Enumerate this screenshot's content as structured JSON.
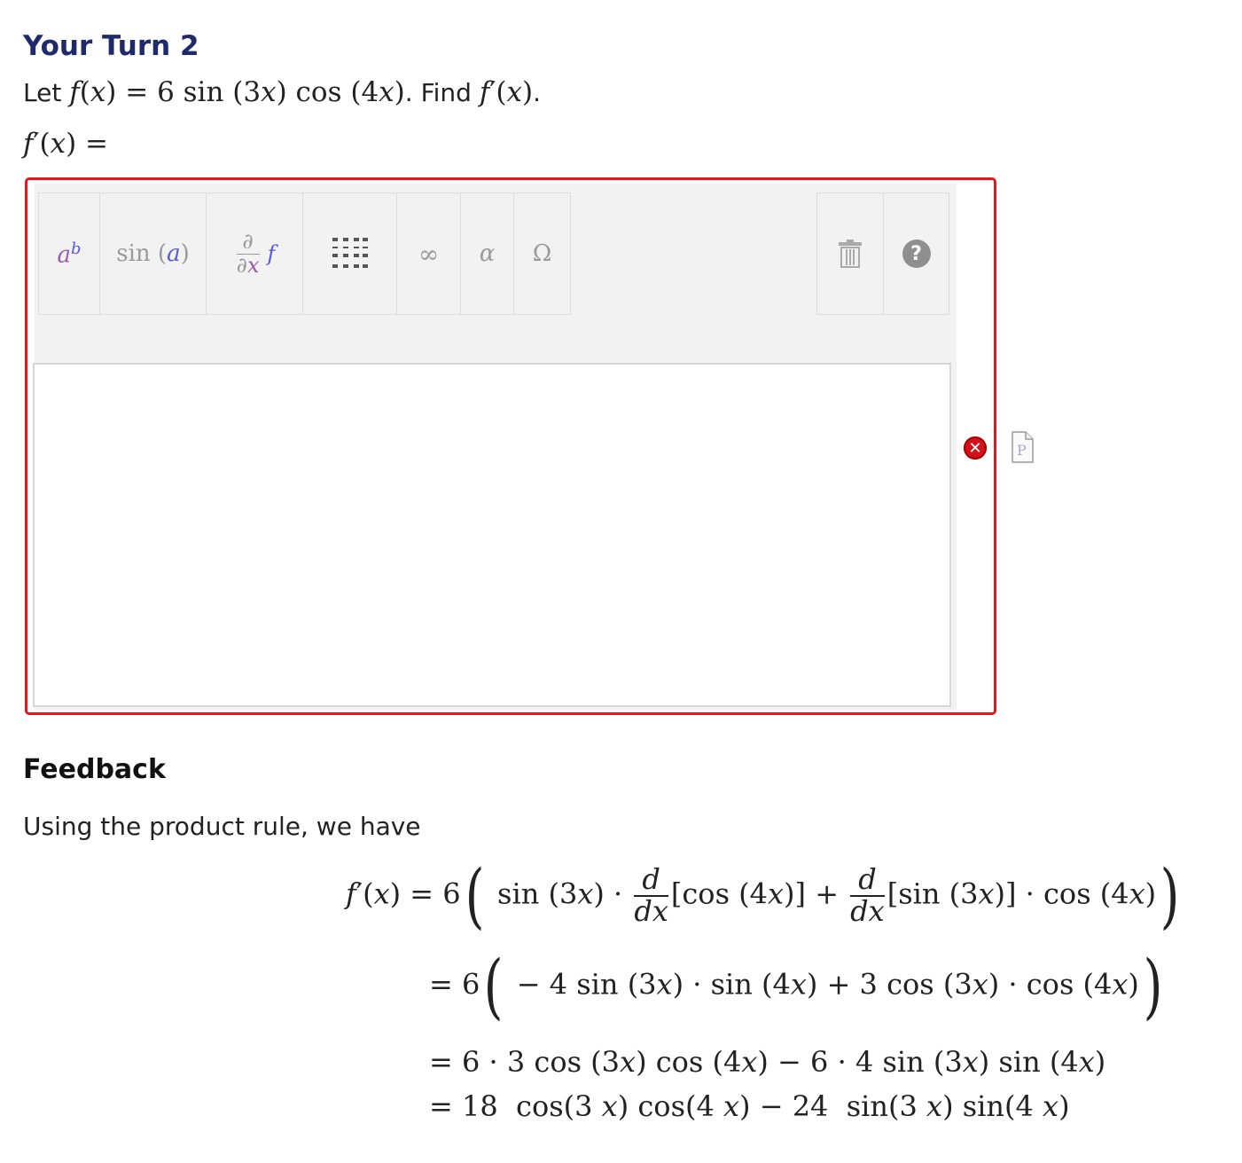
{
  "heading": "Your Turn 2",
  "prompt": {
    "lead": "Let",
    "function_def": "f(x) = 6 sin (3x) cos (4x)",
    "period": ".",
    "find_word": "Find",
    "target": "f′(x)",
    "end": "."
  },
  "answer_prefix": "f′(x) =",
  "toolbar": {
    "buttons": [
      {
        "name": "exponent",
        "label": "a^b"
      },
      {
        "name": "trig",
        "label": "sin (a)"
      },
      {
        "name": "derivative",
        "label": "∂/∂x f"
      },
      {
        "name": "matrix",
        "label": "matrix"
      },
      {
        "name": "infinity",
        "label": "∞"
      },
      {
        "name": "greek",
        "label": "α"
      },
      {
        "name": "symbols",
        "label": "Ω"
      }
    ],
    "trig_label": "sin (a)",
    "infinity_label": "∞",
    "alpha_label": "α",
    "omega_label": "Ω",
    "help_label": "?"
  },
  "answer_value": "",
  "status": {
    "icon": "error-x-icon",
    "color": "#d3121b"
  },
  "preview_icon": "preview-document-icon",
  "feedback": {
    "title": "Feedback",
    "intro": "Using the product rule, we have",
    "lines": [
      "f′(x) = 6( sin (3x) · d/dx [cos (4x)] + d/dx [sin (3x)] · cos (4x) )",
      "= 6( − 4 sin (3x) · sin (4x) + 3 cos (3x) · cos (4x) )",
      "= 6 · 3 cos (3x) cos (4x) − 6 · 4 sin (3x) sin (4x)",
      "= 18 cos(3 x) cos(4 x) − 24 sin(3 x) sin(4 x)"
    ]
  },
  "colors": {
    "heading": "#1f2a6b",
    "error_border": "#e8161b",
    "toolbar_bg": "#f2f2f2",
    "accent_purple": "#9b59b6",
    "accent_blue": "#5b5bd6"
  }
}
